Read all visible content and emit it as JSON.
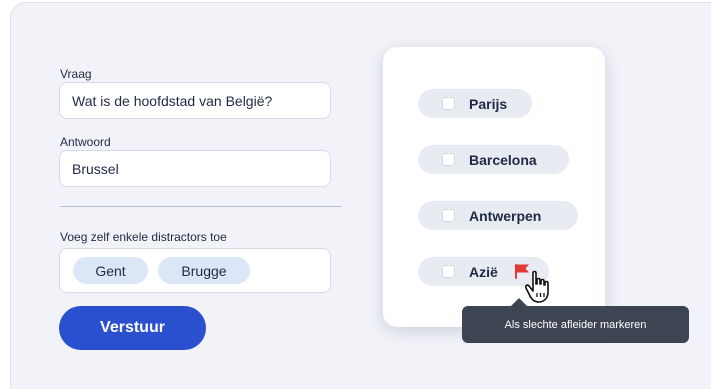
{
  "form": {
    "question_label": "Vraag",
    "question_value": "Wat is de hoofdstad van België?",
    "answer_label": "Antwoord",
    "answer_value": "Brussel",
    "distractors_label": "Voeg zelf enkele distractors toe",
    "distractor_chips": [
      "Gent",
      "Brugge"
    ],
    "submit_label": "Verstuur"
  },
  "options_card": {
    "options": [
      {
        "label": "Parijs"
      },
      {
        "label": "Barcelona"
      },
      {
        "label": "Antwerpen"
      },
      {
        "label": "Azië"
      }
    ]
  },
  "icons": {
    "flag": "flag-icon",
    "cursor": "hand-pointer-icon"
  },
  "tooltip": {
    "text": "Als slechte afleider markeren"
  },
  "colors": {
    "accent": "#2a50cf",
    "flag": "#e53935",
    "chip": "#dbe6f7",
    "tooltip_bg": "#3d4452"
  }
}
